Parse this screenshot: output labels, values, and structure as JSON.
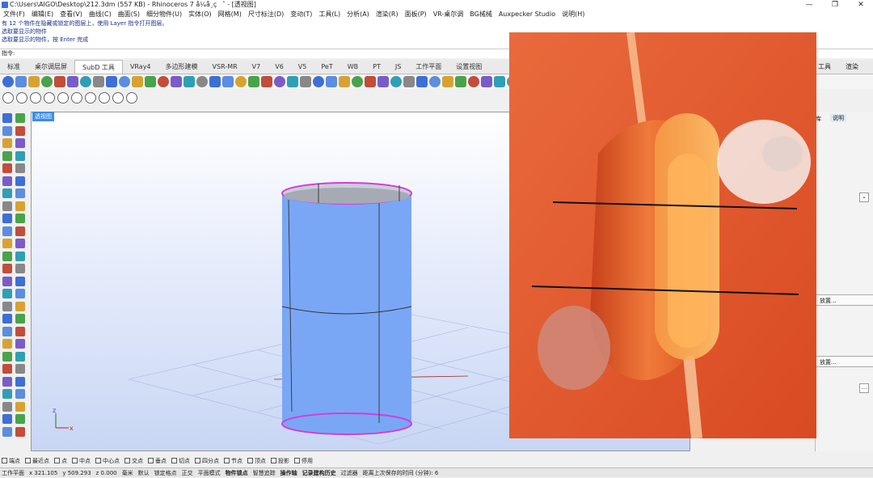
{
  "title": "C:\\Users\\AIGO\\Desktop\\212.3dm (557 KB) - Rhinoceros 7 å¼å¸çˆ - [透视图]",
  "window_controls": [
    "—",
    "❐",
    "✕"
  ],
  "menu": [
    "文件(F)",
    "编辑(E)",
    "查看(V)",
    "曲线(C)",
    "曲面(S)",
    "细分物件(U)",
    "实体(O)",
    "网格(M)",
    "尺寸标注(D)",
    "变动(T)",
    "工具(L)",
    "分析(A)",
    "渲染(R)",
    "面板(P)",
    "VR-桌尔调",
    "BG械械",
    "Auxpecker Studio",
    "说明(H)"
  ],
  "history": {
    "line1": "有 12 个物件在隐藏或锁定的图层上，使用 Layer 指令打开图层。",
    "line2": "选取要显示的物件",
    "line3": "选取要显示的物件，按 Enter 完成"
  },
  "command_prompt": "指令:",
  "tabs": [
    "标准",
    "桌尔调层屏",
    "SubD 工具",
    "VRay4",
    "多边形建模",
    "VSR-MR",
    "V7",
    "V6",
    "V5",
    "PeT",
    "WB",
    "PT",
    "JS",
    "工作平面",
    "设置视图"
  ],
  "tabs_right": [
    "工具",
    "渲染"
  ],
  "active_tab": 2,
  "viewport_label": "透视图",
  "right_panel": {
    "tab_library": "库",
    "tab_help": "说明",
    "place_button_1": "放置...",
    "place_button_2": "放置..."
  },
  "osnap": [
    "端点",
    "最近点",
    "点",
    "中点",
    "中心点",
    "交点",
    "垂点",
    "切点",
    "四分点",
    "节点",
    "顶点",
    "投影",
    "停用"
  ],
  "status": {
    "plane": "工作平面",
    "x": "x 321.105",
    "y": "y 509.293",
    "z": "z 0.000",
    "unit": "毫米",
    "layer": "默认",
    "lock_grid": "锁定格点",
    "ortho": "正交",
    "planar": "平面模式",
    "osnap": "物件锁点",
    "smarttrack": "智慧追踪",
    "gumball": "操作轴",
    "history": "记录建构历史",
    "filter": "过滤器",
    "autosave": "距离上次保存的时间 (分钟): 6"
  },
  "colors": {
    "viewport_tab": "#3a8de8",
    "cylinder": "#7aa7f5",
    "cylinder_edge": "#d63cd6",
    "photo_bg": "#e2562b",
    "earbud_orange": "#e8602a"
  }
}
